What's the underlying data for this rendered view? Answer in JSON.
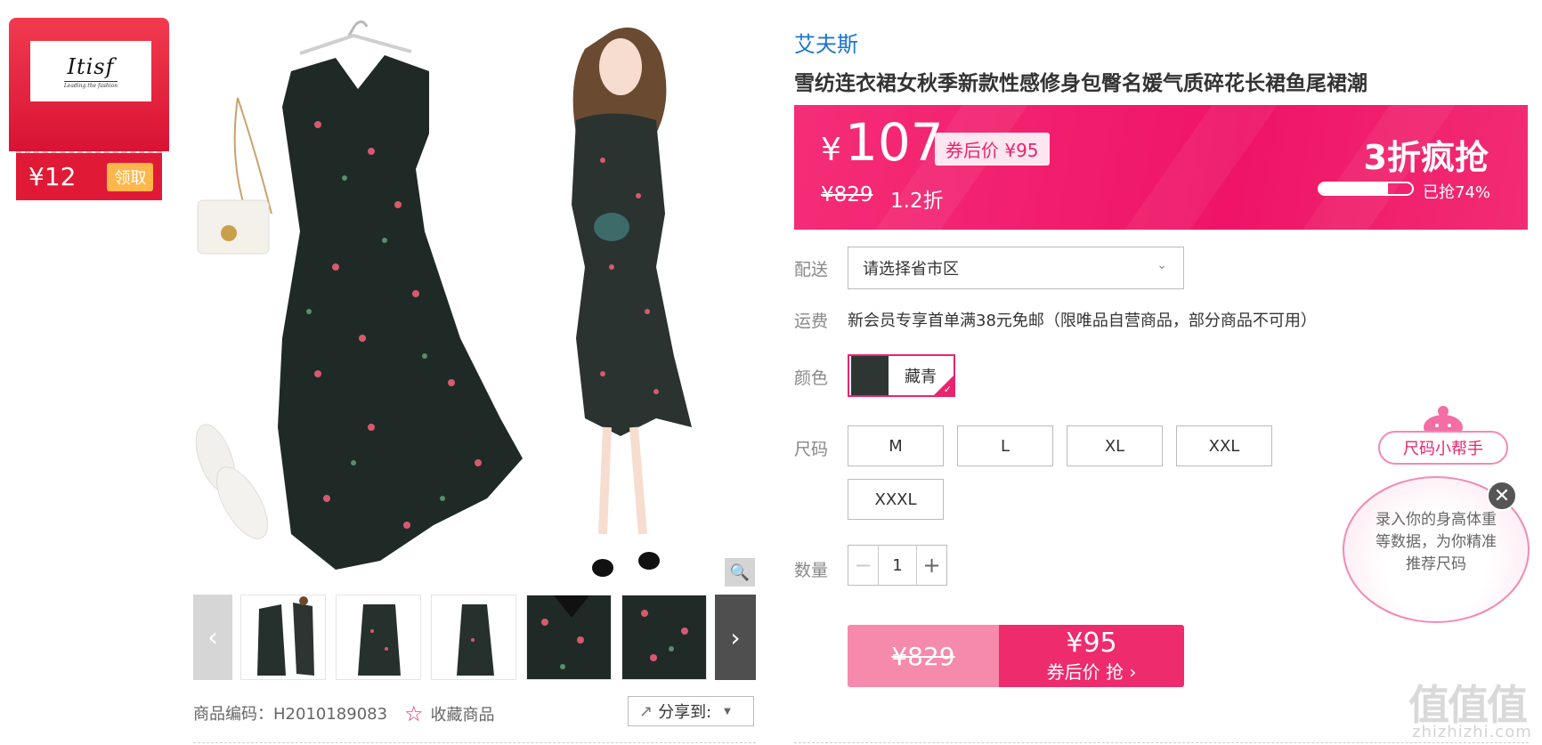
{
  "coupon": {
    "brand": "Itisf",
    "brand_tag": "Leading the fashion",
    "amount": "¥12",
    "button": "领取"
  },
  "gallery": {
    "prev_icon": "chevron-left-icon",
    "next_icon": "chevron-right-icon",
    "zoom_icon": "magnifier-icon"
  },
  "meta": {
    "sku": "商品编码：H2010189083",
    "favorite": "收藏商品",
    "share": "分享到:"
  },
  "product": {
    "brand": "艾夫斯",
    "title": "雪纺连衣裙女秋季新款性感修身包臀名媛气质碎花长裙鱼尾裙潮"
  },
  "price": {
    "currency": "¥",
    "now": "107",
    "after_coupon": "券后价 ¥95",
    "original": "¥829",
    "discount": "1.2折",
    "promo": "3折疯抢",
    "sold_progress": 0.74,
    "sold_text": "已抢74%"
  },
  "delivery": {
    "label": "配送",
    "placeholder": "请选择省市区"
  },
  "shipping": {
    "label": "运费",
    "text": "新会员专享首单满38元免邮（限唯品自营商品，部分商品不可用）"
  },
  "color": {
    "label": "颜色",
    "options": [
      {
        "name": "藏青",
        "selected": true
      }
    ]
  },
  "size": {
    "label": "尺码",
    "options": [
      "M",
      "L",
      "XL",
      "XXL",
      "XXXL"
    ]
  },
  "quantity": {
    "label": "数量",
    "value": "1",
    "minus": "−",
    "plus": "+"
  },
  "buy": {
    "original": "¥829",
    "price": "¥95",
    "sub": "券后价 抢 ›"
  },
  "size_helper": {
    "title": "尺码小帮手",
    "text": "录入你的身高体重等数据，为你精准推荐尺码",
    "close": "✕"
  },
  "watermark": {
    "big": "值值值",
    "small": "zhizhizhi.com"
  },
  "colors": {
    "accent": "#e9246f",
    "link": "#1976d2",
    "banner": "#ef1466",
    "coupon": "#e01a36"
  }
}
